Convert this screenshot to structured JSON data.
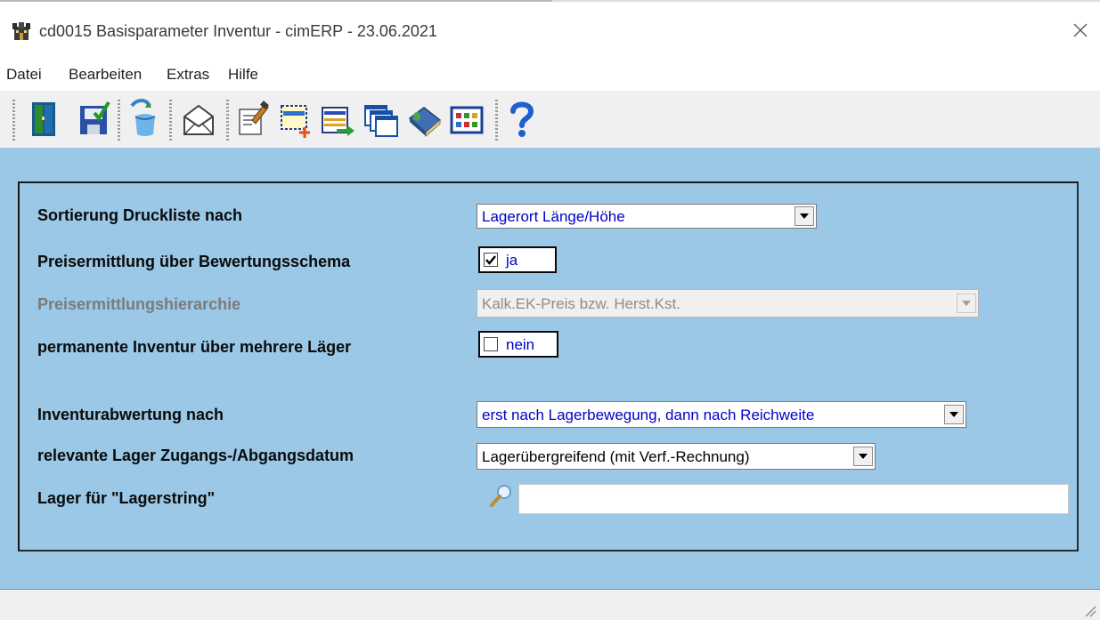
{
  "window": {
    "title": "cd0015 Basisparameter Inventur - cimERP - 23.06.2021",
    "icons": {
      "app": "castle-app-icon",
      "close": "close-icon"
    }
  },
  "menu": {
    "items": [
      {
        "label": "Datei"
      },
      {
        "label": "Bearbeiten"
      },
      {
        "label": "Extras"
      },
      {
        "label": "Hilfe"
      }
    ]
  },
  "toolbar": {
    "buttons": [
      {
        "name": "exit-door-icon"
      },
      {
        "name": "save-disk-icon"
      },
      {
        "name": "refresh-recycle-icon"
      },
      {
        "name": "envelope-mail-icon"
      },
      {
        "name": "edit-document-icon"
      },
      {
        "name": "new-record-icon"
      },
      {
        "name": "transfer-list-icon"
      },
      {
        "name": "windows-stack-icon"
      },
      {
        "name": "book-icon"
      },
      {
        "name": "grid-table-icon"
      },
      {
        "name": "help-question-icon"
      }
    ]
  },
  "form": {
    "sortierung": {
      "label": "Sortierung Druckliste nach",
      "value": "Lagerort Länge/Höhe"
    },
    "preisermittlung": {
      "label": "Preisermittlung über Bewertungsschema",
      "checked": true,
      "text": "ja"
    },
    "hierarchie": {
      "label": "Preisermittlungshierarchie",
      "value": "Kalk.EK-Preis bzw. Herst.Kst.",
      "disabled": true
    },
    "permanente": {
      "label": "permanente Inventur über mehrere Läger",
      "checked": false,
      "text": "nein"
    },
    "abwertung": {
      "label": "Inventurabwertung nach",
      "value": "erst nach Lagerbewegung, dann nach Reichweite"
    },
    "datum": {
      "label": "relevante Lager Zugangs-/Abgangsdatum",
      "value": "Lagerübergreifend (mit Verf.-Rechnung)"
    },
    "lagerstring": {
      "label": "Lager für \"Lagerstring\"",
      "value": ""
    }
  },
  "colors": {
    "client_bg": "#9ac8e6",
    "value_text": "#0000c8",
    "disabled_text": "#7b7b7b"
  }
}
